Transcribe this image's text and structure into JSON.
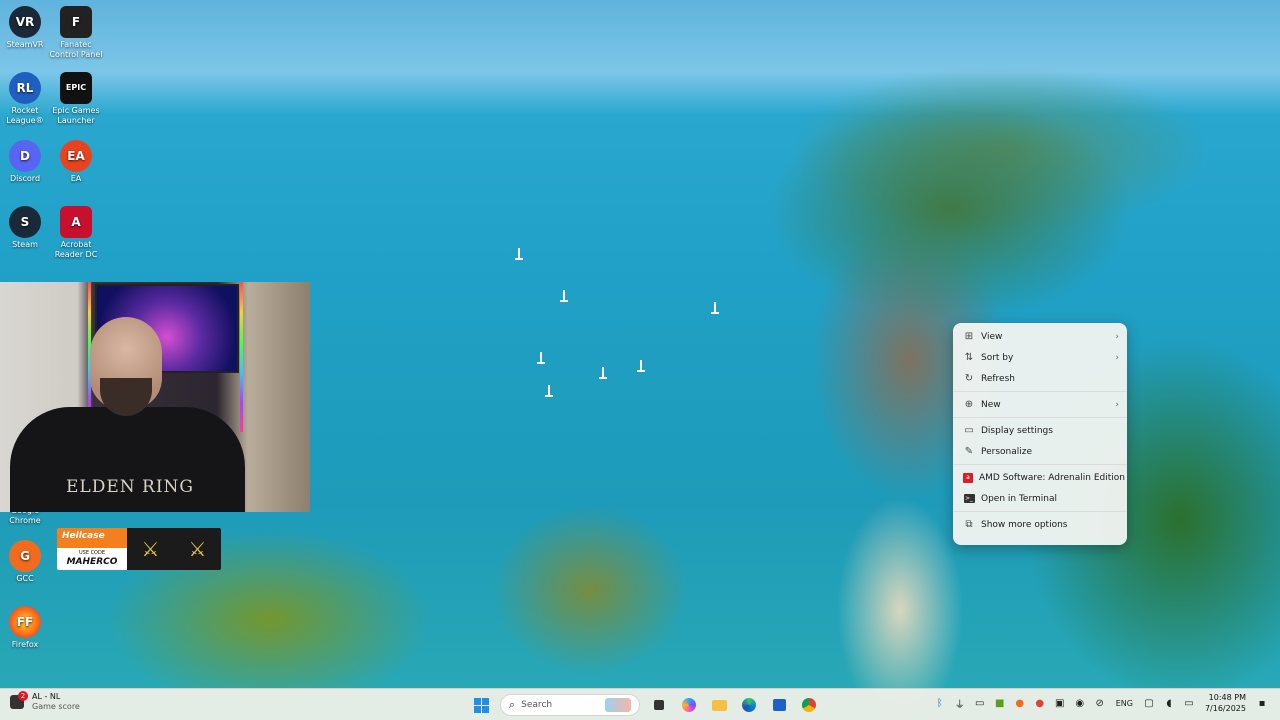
{
  "desktop": {
    "icons": [
      {
        "label": "SteamVR",
        "glyph": "VR",
        "color": "#1b2838"
      },
      {
        "label": "Fanatec Control Panel",
        "glyph": "F",
        "color": "#222222"
      },
      {
        "label": "Rocket League®",
        "glyph": "RL",
        "color": "#1f5fbf"
      },
      {
        "label": "Epic Games Launcher",
        "glyph": "EPIC",
        "color": "#111111"
      },
      {
        "label": "Discord",
        "glyph": "D",
        "color": "#5865f2"
      },
      {
        "label": "EA",
        "glyph": "EA",
        "color": "#e8431e"
      },
      {
        "label": "Steam",
        "glyph": "S",
        "color": "#1b2838"
      },
      {
        "label": "Acrobat Reader DC",
        "glyph": "A",
        "color": "#c8102e"
      },
      {
        "label": "Google Chrome",
        "glyph": "",
        "color": "#00000000"
      },
      {
        "label": "GCC",
        "glyph": "G",
        "color": "#f26b1d"
      },
      {
        "label": "Firefox",
        "glyph": "FF",
        "color": "#ff6611"
      }
    ]
  },
  "overlay": {
    "shirt_text": "ELDEN RING",
    "hellcase": {
      "brand": "Hellcase",
      "code_label": "USE CODE",
      "code": "MAHERCO"
    }
  },
  "context_menu": {
    "items": [
      {
        "label": "View",
        "icon": "grid-icon",
        "glyph": "⊞",
        "submenu": true
      },
      {
        "label": "Sort by",
        "icon": "sort-icon",
        "glyph": "⇅",
        "submenu": true
      },
      {
        "label": "Refresh",
        "icon": "refresh-icon",
        "glyph": "↻",
        "submenu": false
      },
      {
        "label": "New",
        "icon": "plus-icon",
        "glyph": "⊕",
        "submenu": true
      },
      {
        "label": "Display settings",
        "icon": "display-icon",
        "glyph": "▭",
        "submenu": false
      },
      {
        "label": "Personalize",
        "icon": "brush-icon",
        "glyph": "✎",
        "submenu": false
      },
      {
        "label": "AMD Software: Adrenalin Edition",
        "icon": "amd-icon",
        "glyph": "a",
        "submenu": false
      },
      {
        "label": "Open in Terminal",
        "icon": "terminal-icon",
        "glyph": ">_",
        "submenu": false
      },
      {
        "label": "Show more options",
        "icon": "more-options-icon",
        "glyph": "⧉",
        "submenu": false
      }
    ]
  },
  "taskbar": {
    "widget": {
      "title": "AL - NL",
      "subtitle": "Game score",
      "badge": "2"
    },
    "search": {
      "placeholder": "Search"
    },
    "tray": {
      "language": "ENG",
      "time": "10:48 PM",
      "date": "7/16/2025"
    }
  }
}
